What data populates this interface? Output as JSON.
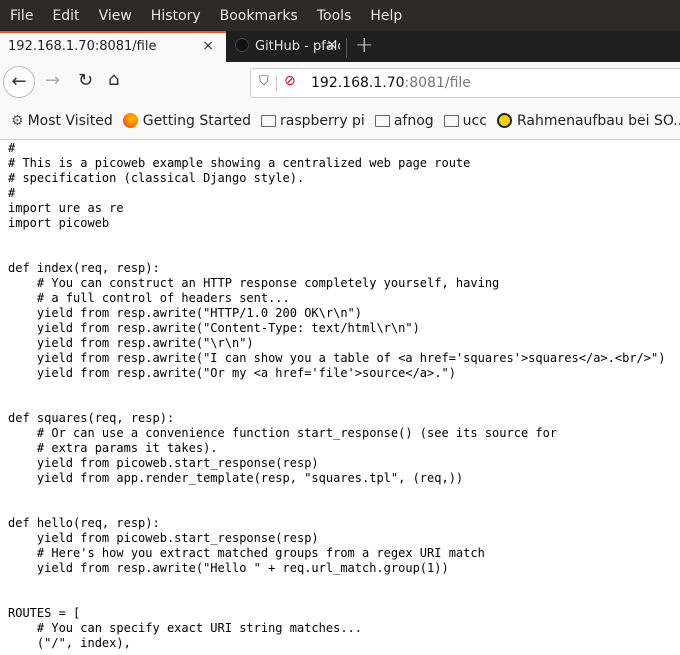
{
  "menu": [
    "File",
    "Edit",
    "View",
    "History",
    "Bookmarks",
    "Tools",
    "Help"
  ],
  "tabs": {
    "active_title": "192.168.1.70:8081/file",
    "second_title": "GitHub - pfalcon/utemplate",
    "close": "×",
    "new_tab": "+"
  },
  "url": {
    "host": "192.168.1.70",
    "rest": ":8081/file"
  },
  "bookmarks": [
    "Most Visited",
    "Getting Started",
    "raspberry pi",
    "afnog",
    "ucc",
    "Rahmenaufbau bei SO..."
  ],
  "code": {
    "lines": [
      "#",
      "# This is a picoweb example showing a centralized web page route",
      "# specification (classical Django style).",
      "#",
      "import ure as re",
      "import picoweb",
      "",
      "",
      "def index(req, resp):",
      "    # You can construct an HTTP response completely yourself, having",
      "    # a full control of headers sent...",
      "    yield from resp.awrite(\"HTTP/1.0 200 OK\\r\\n\")",
      "    yield from resp.awrite(\"Content-Type: text/html\\r\\n\")",
      "    yield from resp.awrite(\"\\r\\n\")",
      "    yield from resp.awrite(\"I can show you a table of <a href='squares'>squares</a>.<br/>\")",
      "    yield from resp.awrite(\"Or my <a href='file'>source</a>.\")",
      "",
      "",
      "def squares(req, resp):",
      "    # Or can use a convenience function start_response() (see its source for",
      "    # extra params it takes).",
      "    yield from picoweb.start_response(resp)",
      "    yield from app.render_template(resp, \"squares.tpl\", (req,))",
      "",
      "",
      "def hello(req, resp):",
      "    yield from picoweb.start_response(resp)",
      "    # Here's how you extract matched groups from a regex URI match",
      "    yield from resp.awrite(\"Hello \" + req.url_match.group(1))",
      "",
      "",
      "ROUTES = [",
      "    # You can specify exact URI string matches...",
      "    (\"/\", index),"
    ]
  }
}
